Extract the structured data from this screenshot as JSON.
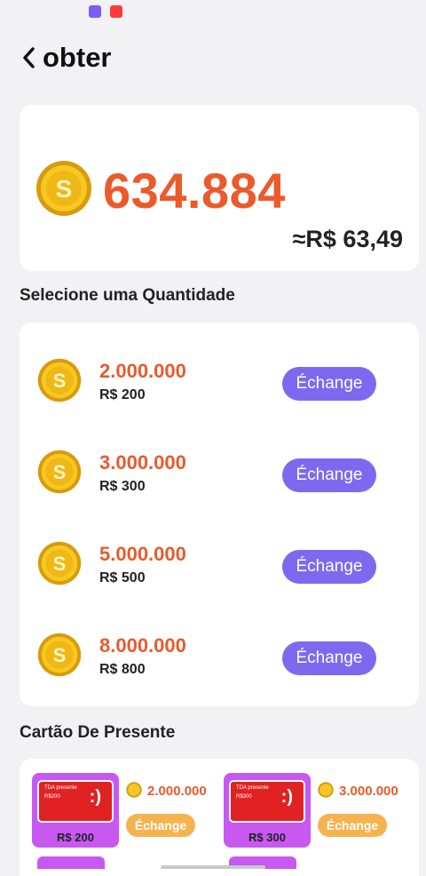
{
  "header": {
    "title": "obter",
    "back_icon": "chevron-left-icon"
  },
  "balance": {
    "coins": "634.884",
    "equivalent": "≈R$ 63,49",
    "icon": "coin-icon"
  },
  "select_section": {
    "title": "Selecione uma Quantidade",
    "items": [
      {
        "coins": "2.000.000",
        "value": "R$ 200",
        "button": "Échange"
      },
      {
        "coins": "3.000.000",
        "value": "R$ 300",
        "button": "Échange"
      },
      {
        "coins": "5.000.000",
        "value": "R$ 500",
        "button": "Échange"
      },
      {
        "coins": "8.000.000",
        "value": "R$ 800",
        "button": "Échange"
      }
    ]
  },
  "gift_section": {
    "title": "Cartão De Presente",
    "cards": [
      {
        "label": "R$ 200",
        "price": "2.000.000",
        "button": "Échange",
        "card_amount": "R$200"
      },
      {
        "label": "R$ 300",
        "price": "3.000.000",
        "button": "Échange",
        "card_amount": "R$300"
      }
    ]
  },
  "colors": {
    "accent": "#7f68f0",
    "coin_text": "#e85a2d",
    "gift_button": "#f5b34f",
    "gift_bg": "#c759f0"
  }
}
